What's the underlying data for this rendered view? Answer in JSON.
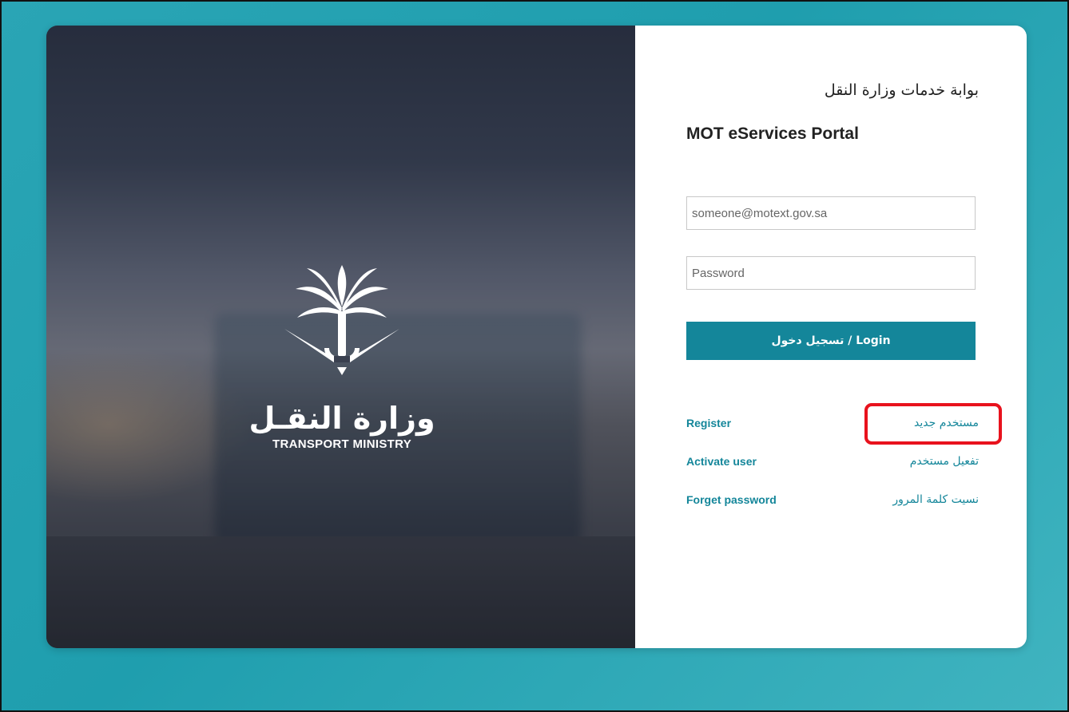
{
  "portal": {
    "title_ar": "بوابة خدمات وزارة النقل",
    "title_en": "MOT eServices Portal"
  },
  "brand": {
    "logo_ar": "وزارة النقـل",
    "logo_en": "TRANSPORT MINISTRY",
    "logo_icon": "palm-swords-emblem-icon"
  },
  "form": {
    "email_placeholder": "someone@motext.gov.sa",
    "email_value": "",
    "password_placeholder": "Password",
    "password_value": "",
    "login_label": "تسجيل دخول / Login"
  },
  "links": {
    "register_en": "Register",
    "register_ar": "مستخدم جديد",
    "activate_en": "Activate user",
    "activate_ar": "تفعيل مستخدم",
    "forget_en": "Forget password",
    "forget_ar": "نسيت كلمة المرور"
  },
  "colors": {
    "accent": "#14869a",
    "background": "#23a3b2",
    "highlight": "#e8121d"
  }
}
